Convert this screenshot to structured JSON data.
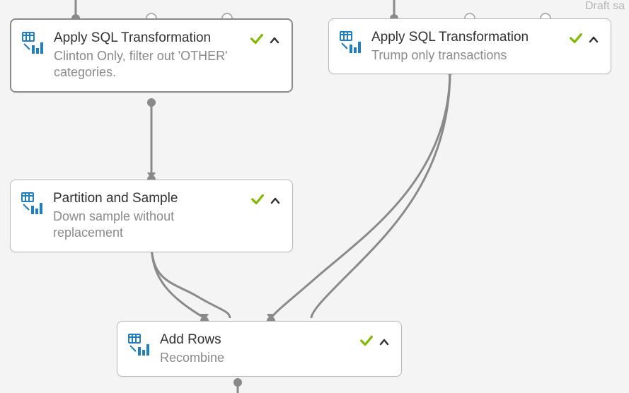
{
  "status_top_right": "Draft sa",
  "nodes": {
    "sql_clinton": {
      "title": "Apply SQL Transformation",
      "desc": "Clinton Only, filter out 'OTHER' categories.",
      "iconColor": "#1f7fbf"
    },
    "sql_trump": {
      "title": "Apply SQL Transformation",
      "desc": "Trump only transactions",
      "iconColor": "#1f7fbf"
    },
    "partition": {
      "title": "Partition and Sample",
      "desc": "Down sample without replacement",
      "iconColor": "#1f7fbf"
    },
    "addrows": {
      "title": "Add Rows",
      "desc": "Recombine",
      "iconColor": "#1f7fbf"
    }
  }
}
